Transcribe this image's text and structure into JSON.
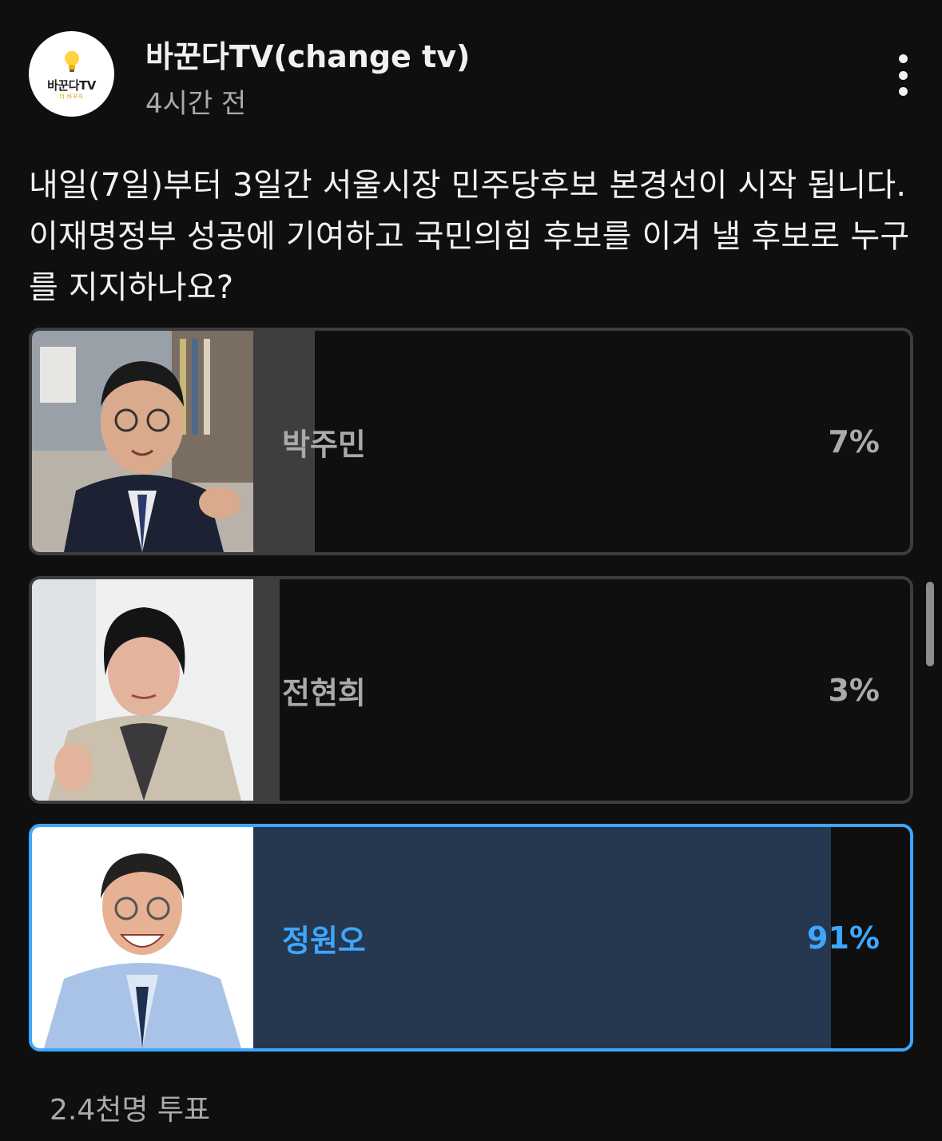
{
  "channel": {
    "name": "바꾼다TV(change tv)",
    "time": "4시간 전",
    "logo_text": "바꾼다TV",
    "logo_sub": "더 바꾸자"
  },
  "post": {
    "question": "내일(7일)부터 3일간 서울시장 민주당후보 본경선이 시작 됩니다. 이재명정부 성공에 기여하고 국민의힘 후보를 이겨 낼 후보로 누구를 지지하나요?"
  },
  "poll": {
    "options": [
      {
        "label": "박주민",
        "percent_text": "7%",
        "percent": 7,
        "selected": false,
        "photo": "candidate-photo-man-glasses-suit"
      },
      {
        "label": "전현희",
        "percent_text": "3%",
        "percent": 3,
        "selected": false,
        "photo": "candidate-photo-woman-beige-coat"
      },
      {
        "label": "정원오",
        "percent_text": "91%",
        "percent": 91,
        "selected": true,
        "photo": "candidate-photo-man-smiling-blue-shirt"
      }
    ],
    "vote_count": "2.4천명 투표"
  },
  "icons": {
    "menu": "more-vertical-icon",
    "logo": "lightbulb-icon"
  },
  "colors": {
    "background": "#0f0f0f",
    "accent": "#3ea6ff",
    "bar": "#3e3e3e",
    "selected_bar": "#263850",
    "muted_text": "#aaaaaa"
  }
}
